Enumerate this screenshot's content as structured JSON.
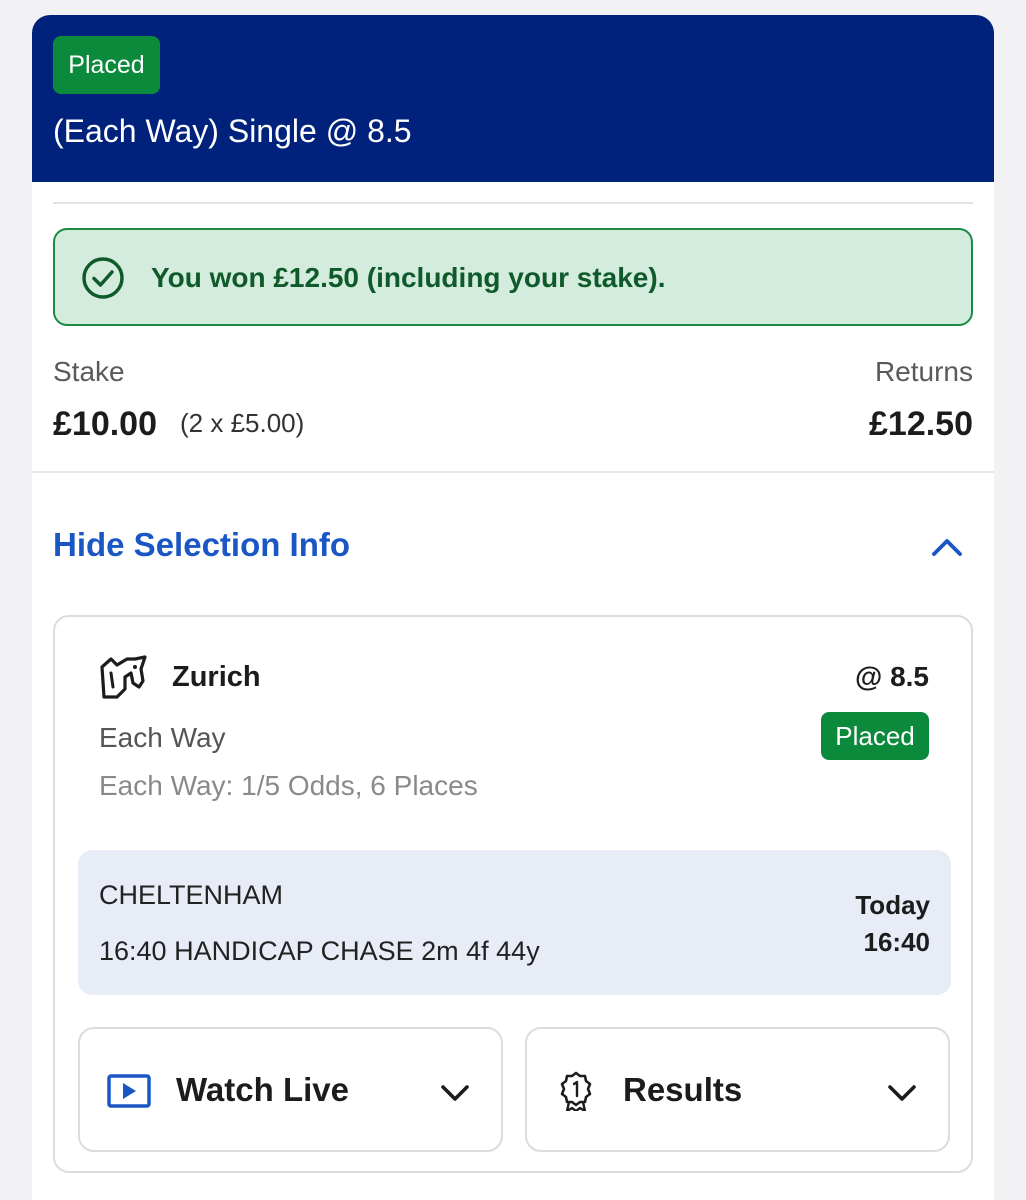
{
  "header": {
    "status_badge": "Placed",
    "title": "(Each Way) Single @ 8.5"
  },
  "win_banner": {
    "message": "You won £12.50 (including your stake)."
  },
  "summary": {
    "stake_label": "Stake",
    "stake_value": "£10.00",
    "stake_breakdown": "(2 x £5.00)",
    "returns_label": "Returns",
    "returns_value": "£12.50"
  },
  "selection_toggle": {
    "label": "Hide Selection Info"
  },
  "selection": {
    "name": "Zurich",
    "odds": "@ 8.5",
    "market": "Each Way",
    "status_badge": "Placed",
    "terms": "Each Way: 1/5 Odds, 6 Places",
    "event": {
      "venue": "CHELTENHAM",
      "race": "16:40 HANDICAP CHASE 2m 4f 44y",
      "day": "Today",
      "time": "16:40"
    }
  },
  "actions": {
    "watch_live_label": "Watch Live",
    "results_label": "Results"
  },
  "colors": {
    "header_bg": "#00227d",
    "placed_badge": "#0b8a3c",
    "win_banner_bg": "#d4ecdd",
    "link_blue": "#1a56c4",
    "event_bg": "#e7ecf7"
  },
  "icons": {
    "win": "check-circle-icon",
    "collapse": "chevron-up-icon",
    "horse": "horse-racing-icon",
    "watch": "play-video-icon",
    "results": "award-ribbon-icon",
    "expand": "chevron-down-icon"
  }
}
